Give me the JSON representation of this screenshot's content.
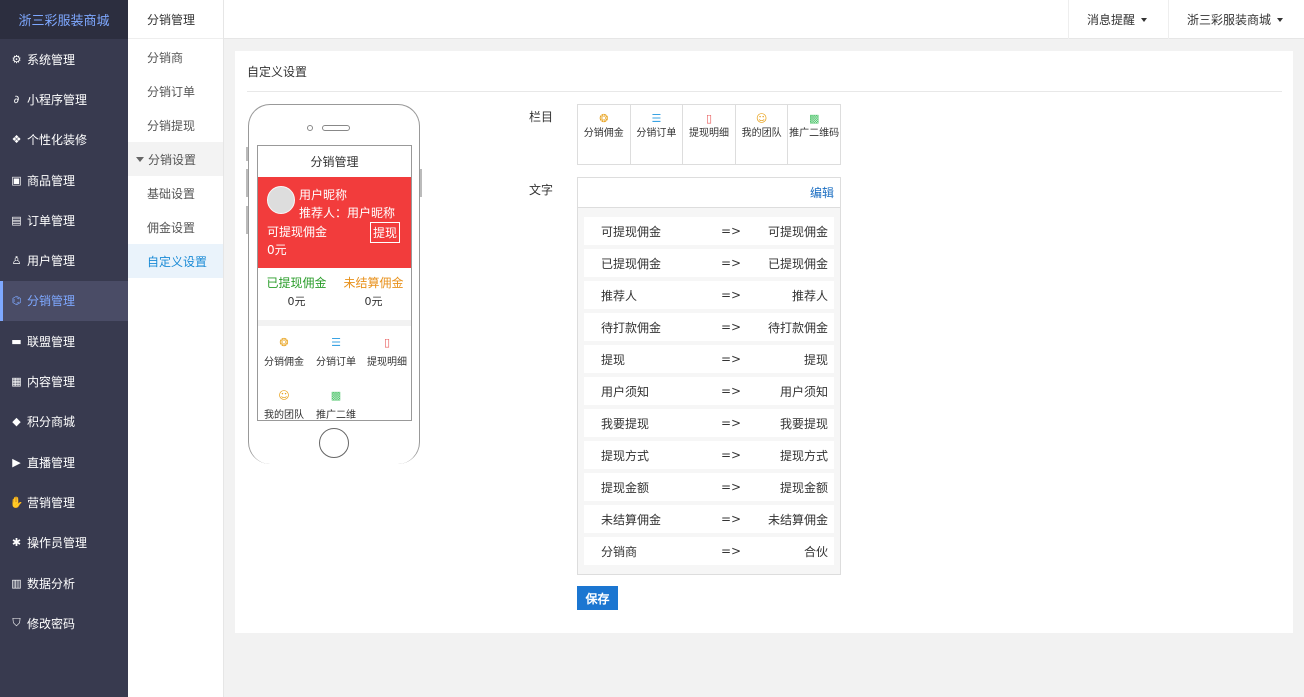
{
  "sidebar": {
    "brand": "浙三彩服装商城",
    "items": [
      {
        "label": "系统管理",
        "icon": "gear-icon"
      },
      {
        "label": "小程序管理",
        "icon": "link-icon"
      },
      {
        "label": "个性化装修",
        "icon": "diamond-icon"
      },
      {
        "label": "商品管理",
        "icon": "bag-icon"
      },
      {
        "label": "订单管理",
        "icon": "clipboard-icon"
      },
      {
        "label": "用户管理",
        "icon": "user-icon"
      },
      {
        "label": "分销管理",
        "icon": "sitemap-icon"
      },
      {
        "label": "联盟管理",
        "icon": "store-icon"
      },
      {
        "label": "内容管理",
        "icon": "news-icon"
      },
      {
        "label": "积分商城",
        "icon": "cube-icon"
      },
      {
        "label": "直播管理",
        "icon": "play-icon"
      },
      {
        "label": "营销管理",
        "icon": "hand-icon"
      },
      {
        "label": "操作员管理",
        "icon": "cog-icon"
      },
      {
        "label": "数据分析",
        "icon": "chart-icon"
      },
      {
        "label": "修改密码",
        "icon": "shield-icon"
      }
    ]
  },
  "submenu": {
    "title": "分销管理",
    "items": [
      "分销商",
      "分销订单",
      "分销提现"
    ],
    "group": "分销设置",
    "group_items": [
      "基础设置",
      "佣金设置",
      "自定义设置"
    ]
  },
  "topbar": {
    "messages": "消息提醒",
    "store": "浙三彩服装商城"
  },
  "panel": {
    "title": "自定义设置"
  },
  "phone": {
    "screen_title": "分销管理",
    "nickname": "用户昵称",
    "referrer": "推荐人：用户昵称",
    "withdrawable": "可提现佣金",
    "withdraw_btn": "提现",
    "amount": "0元",
    "withdrawn_label": "已提现佣金",
    "withdrawn_value": "0元",
    "unsettled_label": "未结算佣金",
    "unsettled_value": "0元",
    "grid": [
      "分销佣金",
      "分销订单",
      "提现明细",
      "我的团队",
      "推广二维"
    ]
  },
  "columns": {
    "label": "栏目",
    "items": [
      "分销佣金",
      "分销订单",
      "提现明细",
      "我的团队",
      "推广二维码"
    ]
  },
  "text_settings": {
    "label": "文字",
    "edit": "编辑",
    "rows": [
      {
        "key": "可提现佣金",
        "arrow": "=>",
        "value": "可提现佣金"
      },
      {
        "key": "已提现佣金",
        "arrow": "=>",
        "value": "已提现佣金"
      },
      {
        "key": "推荐人",
        "arrow": "=>",
        "value": "推荐人"
      },
      {
        "key": "待打款佣金",
        "arrow": "=>",
        "value": "待打款佣金"
      },
      {
        "key": "提现",
        "arrow": "=>",
        "value": "提现"
      },
      {
        "key": "用户须知",
        "arrow": "=>",
        "value": "用户须知"
      },
      {
        "key": "我要提现",
        "arrow": "=>",
        "value": "我要提现"
      },
      {
        "key": "提现方式",
        "arrow": "=>",
        "value": "提现方式"
      },
      {
        "key": "提现金额",
        "arrow": "=>",
        "value": "提现金额"
      },
      {
        "key": "未结算佣金",
        "arrow": "=>",
        "value": "未结算佣金"
      },
      {
        "key": "分销商",
        "arrow": "=>",
        "value": "合伙"
      }
    ]
  },
  "save_button": "保存",
  "colors": {
    "sidebar_bg": "#383a4f",
    "accent": "#7ea8ff",
    "red_card": "#f23c3c",
    "primary_button": "#1b76d1",
    "withdrawn": "#2a9d2a",
    "unsettled": "#e8911c"
  }
}
